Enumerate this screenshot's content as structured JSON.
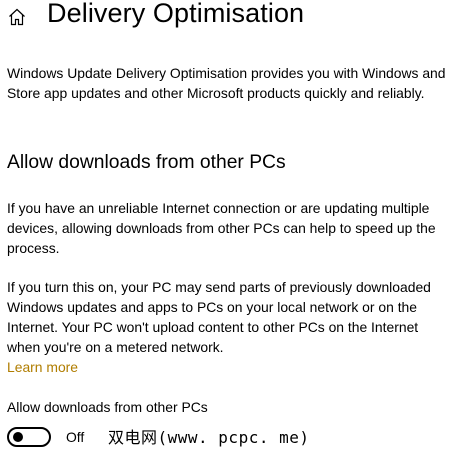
{
  "header": {
    "home_icon": "home-icon",
    "title": "Delivery Optimisation"
  },
  "intro": "Windows Update Delivery Optimisation provides you with Windows and Store app updates and other Microsoft products quickly and reliably.",
  "section": {
    "title": "Allow downloads from other PCs",
    "paragraph1": "If you have an unreliable Internet connection or are updating multiple devices, allowing downloads from other PCs can help to speed up the process.",
    "paragraph2": "If you turn this on, your PC may send parts of previously downloaded Windows updates and apps to PCs on your local network or on the Internet. Your PC won't upload content to other PCs on the Internet when you're on a metered network.",
    "learn_more": "Learn more",
    "link_color": "#b07d00"
  },
  "toggle": {
    "label": "Allow downloads from other PCs",
    "state_text": "Off",
    "is_on": false
  },
  "watermark": "双电网(www. pcpc. me)"
}
